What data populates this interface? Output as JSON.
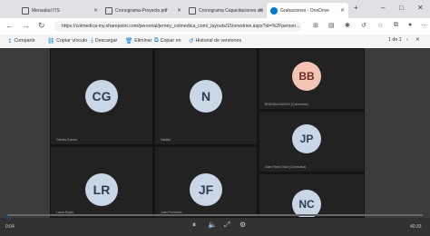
{
  "tabs": [
    {
      "label": "Mensabul ITS"
    },
    {
      "label": "Cronograma-Proyecto.pdf"
    },
    {
      "label": "Cronograma Capacitaciones sin"
    },
    {
      "label": "Grabaciones - OneDrive"
    }
  ],
  "window": {
    "minimize": "–",
    "maximize": "□",
    "close": "✕"
  },
  "address": {
    "url": "https://colmedica-my.sharepoint.com/personal/jerney_colmedica_com/_layouts/15/onedrive.aspx?id=%2Fperson..."
  },
  "toolbar": {
    "share": "Compartir",
    "copy_link": "Copiar vínculo",
    "download": "Descargar",
    "delete": "Eliminar",
    "copy_to": "Copiar en",
    "version_history": "Historial de versiones",
    "page_count": "1 de 1"
  },
  "participants": [
    {
      "initials": "CG",
      "name": "Camila Gomez"
    },
    {
      "initials": "N",
      "name": "Natalia"
    },
    {
      "initials": "BB",
      "name": "BRENDA BUENO (Colmedica)"
    },
    {
      "initials": "JP",
      "name": "Juan Pablo Diaz (Colmedica)"
    },
    {
      "initials": "LR",
      "name": "Laura Rojas"
    },
    {
      "initials": "JF",
      "name": "Juan Fernando"
    },
    {
      "initials": "NC",
      "name": ""
    }
  ],
  "player": {
    "elapsed": "0:04",
    "total": "40:33",
    "progress": 0.0016
  },
  "colors": {
    "avatar_light": "#c8d6e6",
    "avatar_pink": "#f4c4b4",
    "accent": "#0078d4"
  }
}
